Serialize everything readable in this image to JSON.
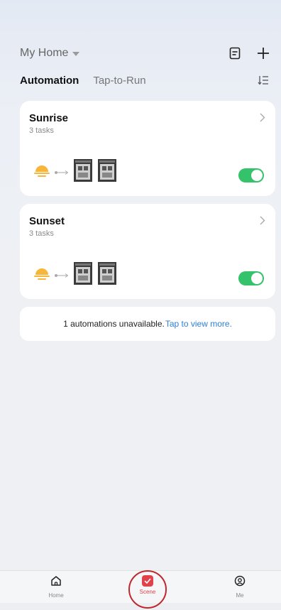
{
  "header": {
    "home_name": "My Home"
  },
  "tabs": [
    {
      "label": "Automation"
    },
    {
      "label": "Tap-to-Run"
    }
  ],
  "automations": [
    {
      "title": "Sunrise",
      "tasks": "3 tasks",
      "enabled": true
    },
    {
      "title": "Sunset",
      "tasks": "3 tasks",
      "enabled": true
    }
  ],
  "notice": {
    "message": "1 automations unavailable.",
    "link": "Tap to view more."
  },
  "bottom_nav": [
    {
      "label": "Home",
      "icon": "home-icon"
    },
    {
      "label": "Scene",
      "icon": "scene-icon",
      "active": true
    },
    {
      "label": "Me",
      "icon": "profile-icon"
    }
  ],
  "colors": {
    "accent_green": "#34c26a",
    "scene_red": "#e0424b",
    "link_blue": "#2f7fd6",
    "sun_orange": "#f7b63a"
  }
}
